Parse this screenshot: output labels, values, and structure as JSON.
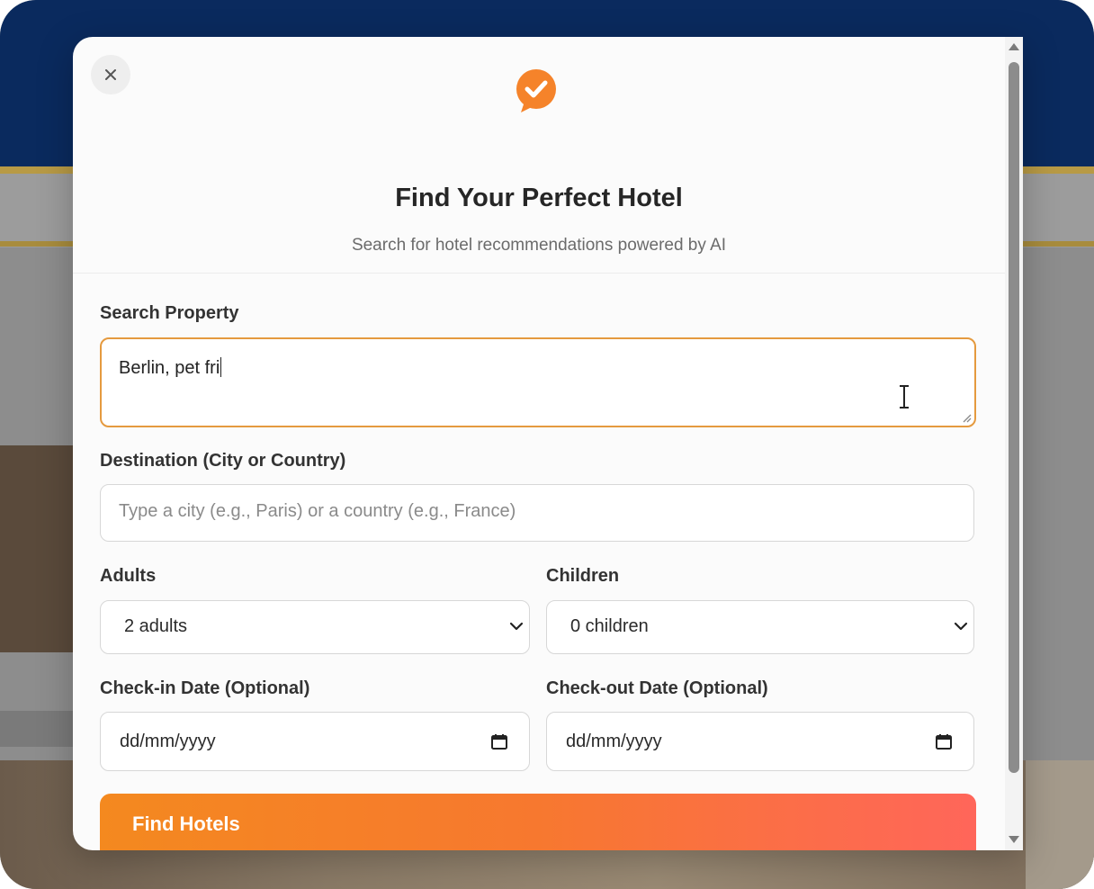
{
  "colors": {
    "accent": "#e59a3f",
    "button_start": "#f4891f",
    "button_end": "#ff665a",
    "backdrop_nav": "#0a2a5e"
  },
  "modal": {
    "close_icon": "close-icon",
    "logo_icon": "checkmark-chat-bubble-icon",
    "title": "Find Your Perfect Hotel",
    "subtitle": "Search for hotel recommendations powered by AI"
  },
  "form": {
    "search_property": {
      "label": "Search Property",
      "value": "Berlin, pet fri"
    },
    "destination": {
      "label": "Destination (City or Country)",
      "placeholder": "Type a city (e.g., Paris) or a country (e.g., France)"
    },
    "adults": {
      "label": "Adults",
      "selected": "2 adults"
    },
    "children": {
      "label": "Children",
      "selected": "0 children"
    },
    "checkin": {
      "label": "Check-in Date (Optional)",
      "value": "dd/mm/yyyy"
    },
    "checkout": {
      "label": "Check-out Date (Optional)",
      "value": "dd/mm/yyyy"
    },
    "submit_label": "Find Hotels"
  }
}
